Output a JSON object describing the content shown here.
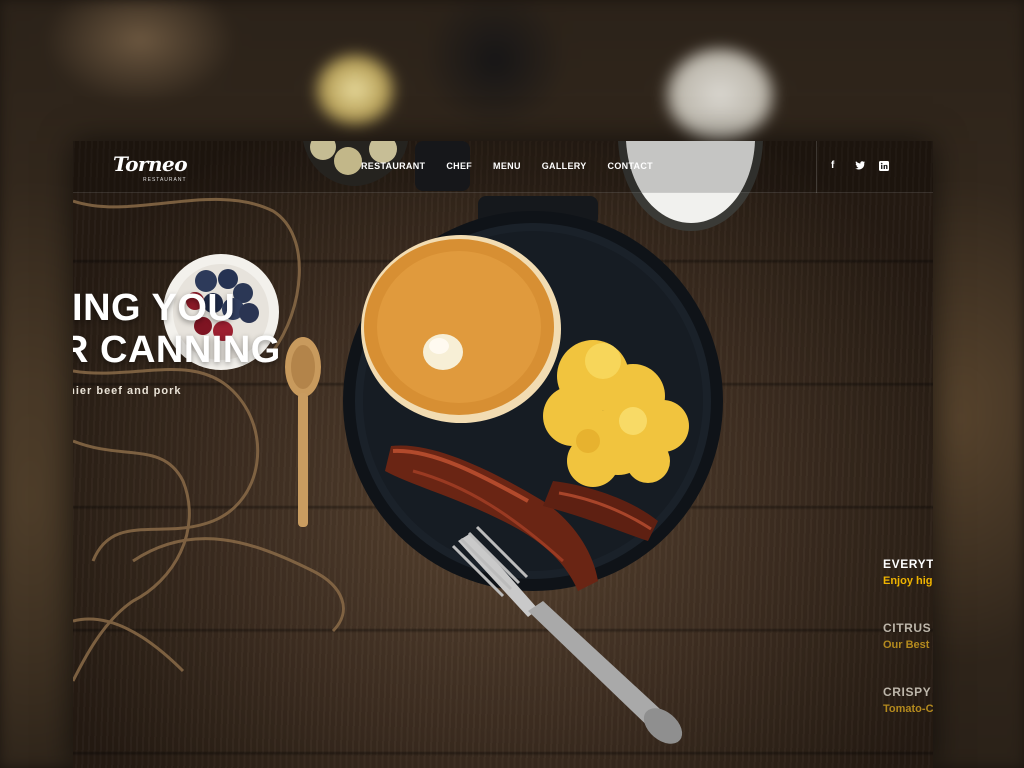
{
  "brand": {
    "name": "Torneo",
    "tagline": "RESTAURANT"
  },
  "nav": {
    "items": [
      "RESTAURANT",
      "CHEF",
      "MENU",
      "GALLERY",
      "CONTACT"
    ]
  },
  "social": {
    "icons": [
      "facebook-icon",
      "twitter-icon",
      "linkedin-icon"
    ],
    "glyphs": [
      "f",
      "t",
      "in"
    ]
  },
  "hero": {
    "line1": "IING YOU",
    "line2": "R CANNING",
    "subtitle": "chier beef and pork"
  },
  "features": [
    {
      "title": "EVERYTI",
      "subtitle": "Enjoy high"
    },
    {
      "title": "CITRUS ,",
      "subtitle": "Our Best S"
    },
    {
      "title": "CRISPY I",
      "subtitle": "Tomato-C"
    }
  ],
  "colors": {
    "accent": "#f0b400",
    "accent_dim": "#b48a1e",
    "wood_dark": "#241a12",
    "wood_mid": "#5a4431"
  }
}
